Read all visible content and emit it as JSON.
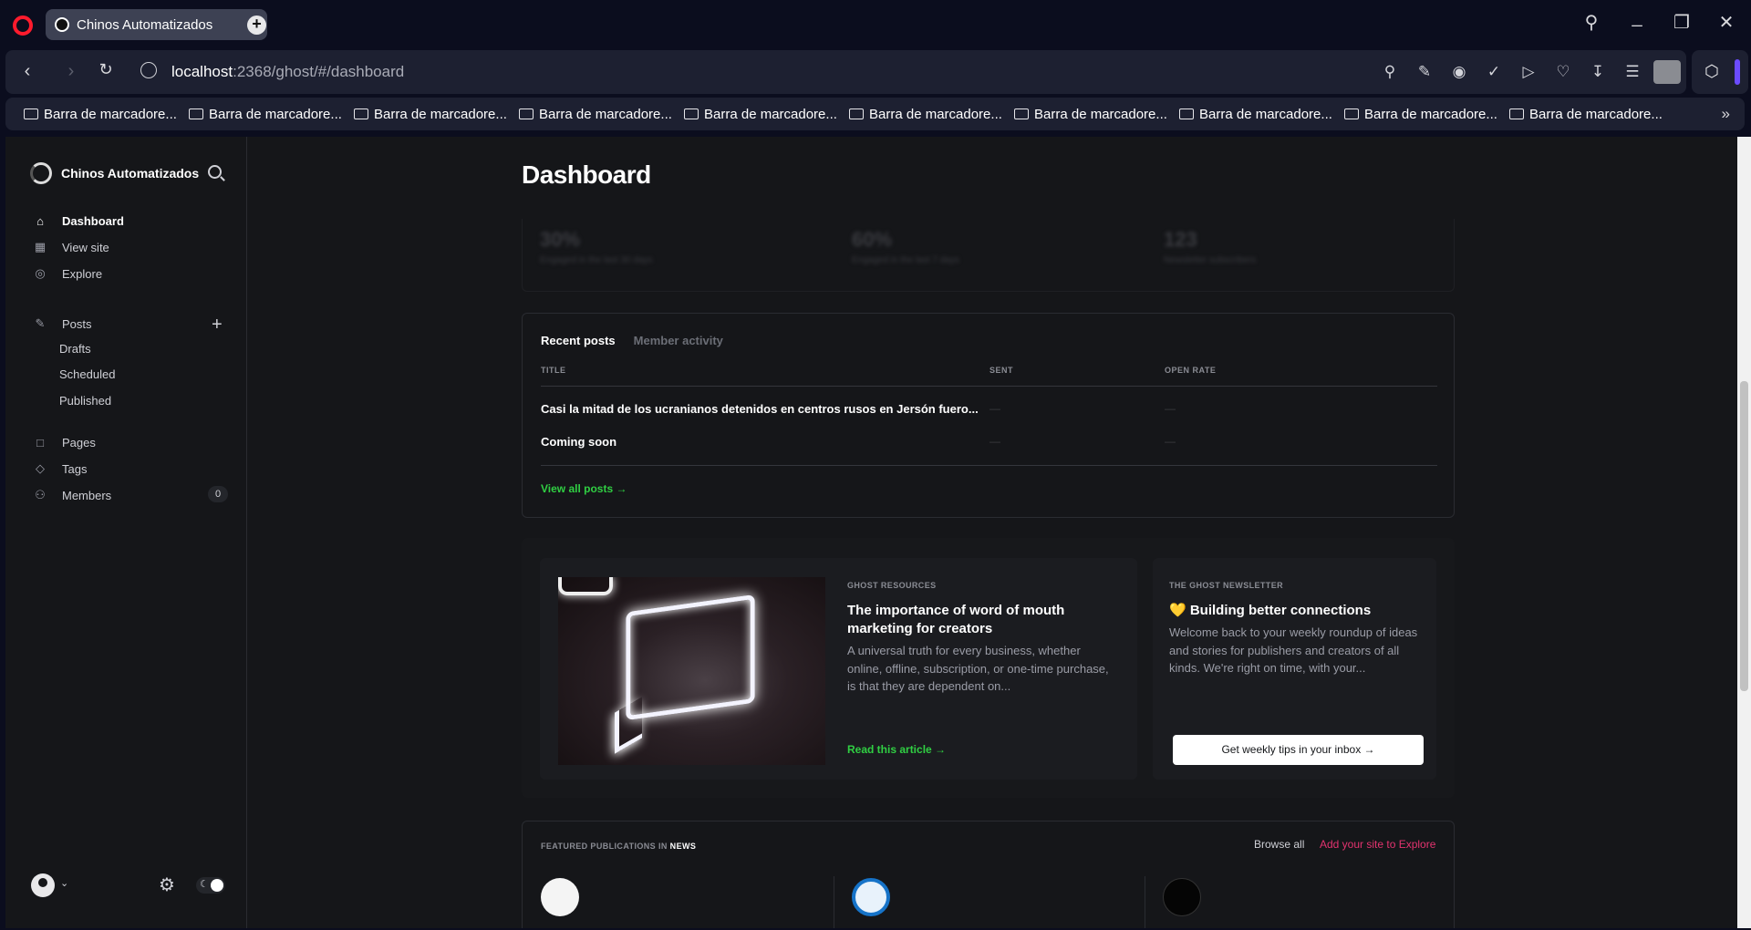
{
  "browser": {
    "tab_title": "Chinos Automatizados",
    "url_host": "localhost",
    "url_rest": ":2368/ghost/#/dashboard",
    "bookmarks": [
      "Barra de marcadore...",
      "Barra de marcadore...",
      "Barra de marcadore...",
      "Barra de marcadore...",
      "Barra de marcadore...",
      "Barra de marcadore...",
      "Barra de marcadore...",
      "Barra de marcadore...",
      "Barra de marcadore...",
      "Barra de marcadore..."
    ],
    "accent": "#ff1b2d"
  },
  "sidebar": {
    "site_name": "Chinos Automatizados",
    "nav": {
      "dashboard": "Dashboard",
      "view_site": "View site",
      "explore": "Explore",
      "posts": "Posts",
      "drafts": "Drafts",
      "scheduled": "Scheduled",
      "published": "Published",
      "pages": "Pages",
      "tags": "Tags",
      "members": "Members",
      "members_count": "0"
    }
  },
  "main": {
    "title": "Dashboard",
    "stats": [
      {
        "value": "30%",
        "label": "Engaged in the last 30 days"
      },
      {
        "value": "60%",
        "label": "Engaged in the last 7 days"
      },
      {
        "value": "123",
        "label": "Newsletter subscribers"
      }
    ],
    "recent": {
      "tab_active": "Recent posts",
      "tab_inactive": "Member activity",
      "col_title": "TITLE",
      "col_sent": "SENT",
      "col_open_rate": "OPEN RATE",
      "posts": [
        {
          "title": "Casi la mitad de los ucranianos detenidos en centros rusos en Jersón fuero...",
          "sent": "—",
          "open_rate": "—"
        },
        {
          "title": "Coming soon",
          "sent": "—",
          "open_rate": "—"
        }
      ],
      "view_all": "View all posts →"
    },
    "resources": {
      "eyebrow": "GHOST RESOURCES",
      "title": "The importance of word of mouth marketing for creators",
      "body": "A universal truth for every business, whether online, offline, subscription, or one-time purchase, is that they are dependent on...",
      "link": "Read this article →"
    },
    "newsletter": {
      "eyebrow": "THE GHOST NEWSLETTER",
      "title": "💛 Building better connections",
      "body": "Welcome back to your weekly roundup of ideas and stories for publishers and creators of all kinds. We're right on time, with your...",
      "button": "Get weekly tips in your inbox →"
    },
    "featured": {
      "eyebrow_prefix": "FEATURED PUBLICATIONS IN",
      "eyebrow_category": "NEWS",
      "browse_all": "Browse all",
      "add_site": "Add your site to Explore",
      "add_site_color": "#e3336f"
    }
  }
}
